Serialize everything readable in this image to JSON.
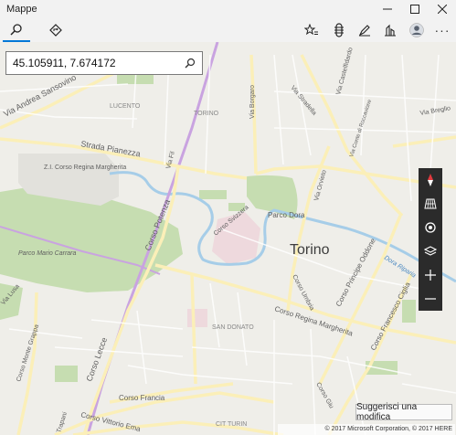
{
  "window": {
    "title": "Mappe"
  },
  "search": {
    "value": "45.105911, 7.674172"
  },
  "map_labels": {
    "torino": "Torino",
    "parco_dora": "Parco Dora",
    "parco_mario_carrara": "Parco Mario Carrara",
    "zi_corso_regina": "Z.I. Corso Regina Margherita",
    "lucento": "LUCENTO",
    "torino_small": "TORINO",
    "san_donato": "SAN DONATO",
    "cit_turin": "CIT TURIN",
    "via_andrea_sansovino": "Via Andrea Sansovino",
    "strada_pianezza": "Strada Pianezza",
    "corso_potenza": "Corso Potenza",
    "corso_lecce": "Corso Lecce",
    "corso_svizzera": "Corso Svizzera",
    "corso_regina_margherita": "Corso Regina Margherita",
    "corso_francia": "Corso Francia",
    "corso_vittorio_emanuele": "Corso Vittorio Ema",
    "corso_umbria": "Corso Umbria",
    "corso_principe_oddone": "Corso Principe Oddone",
    "corso_francesco_ciglia": "Corso Francesco Ciglia",
    "corso_monte_grappa": "Corso Monte Grappa",
    "via_borgaro": "Via Borgaro",
    "via_orvieto": "Via Orvieto",
    "via_stradella": "Via Stradella",
    "via_castelfidardo": "Via Castelfidardo",
    "via_breglio": "Via Breglio",
    "via_conte_di_roccavione": "Via Conte di Roccavione",
    "via_fil": "Via Fil",
    "via_lusa": "Via Lusa",
    "dora_riparia": "Dora Riparia",
    "corso_giulio": "Corso Giu",
    "trapani": "Trapani"
  },
  "suggest_button": "Suggerisci una modifica",
  "copyright": "© 2017 Microsoft Corporation, © 2017 HERE",
  "colors": {
    "park": "#c6ddb1",
    "water": "#a6cde8",
    "road": "#fbefb8",
    "tram": "#c9a3e0",
    "land": "#efeee9"
  }
}
